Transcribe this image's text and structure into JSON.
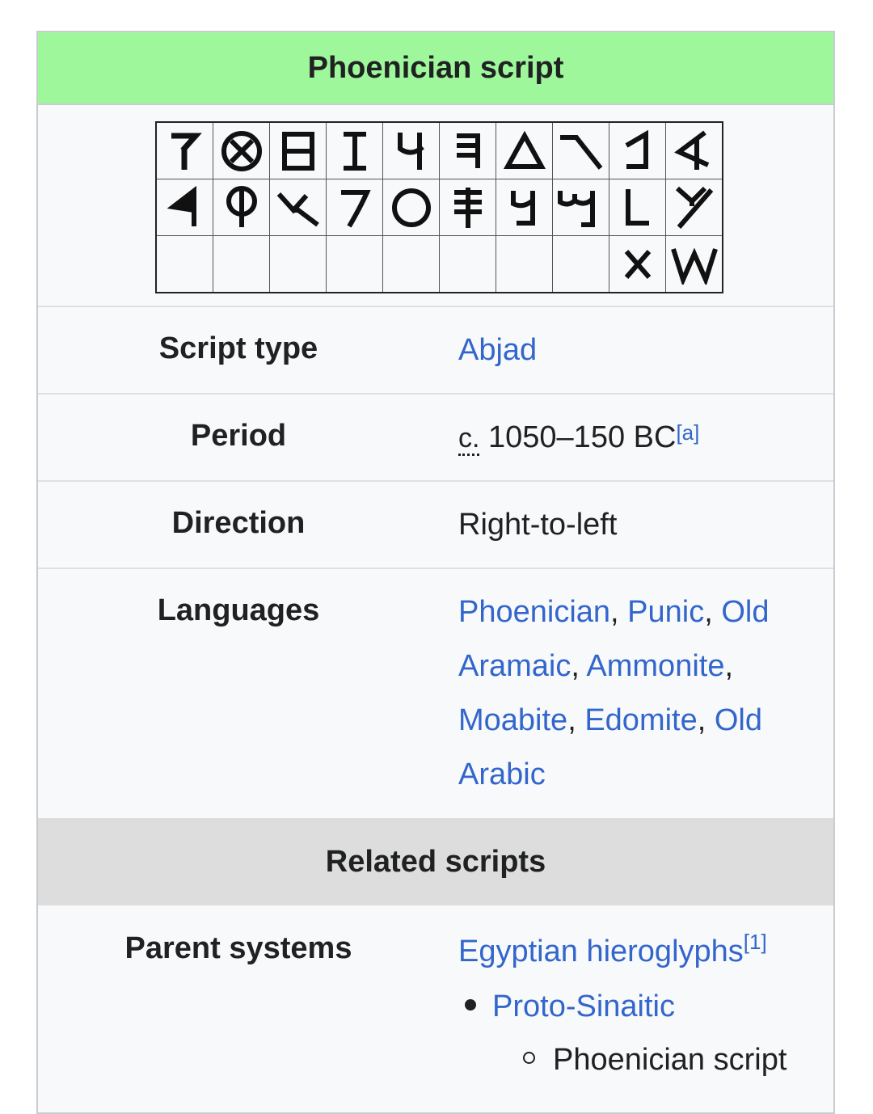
{
  "infobox": {
    "title": "Phoenician script",
    "rows": [
      {
        "label": "Script type",
        "value": "Abjad"
      },
      {
        "label": "Period",
        "abbr": "c.",
        "value": " 1050–150 BC",
        "note": "[a]"
      },
      {
        "label": "Direction",
        "value": "Right-to-left"
      },
      {
        "label": "Languages",
        "links": [
          "Phoenician",
          "Punic",
          "Old Aramaic",
          "Ammonite",
          "Moabite",
          "Edomite",
          "Old Arabic"
        ]
      }
    ],
    "section_header": "Related scripts",
    "parent": {
      "label": "Parent systems",
      "root": "Egyptian hieroglyphs",
      "root_note": "[1]",
      "child": "Proto-Sinaitic",
      "grandchild": "Phoenician script"
    }
  },
  "glyph_chart_icons": [
    "zayin-glyph",
    "teth-glyph",
    "heth-glyph",
    "zayin-i-glyph",
    "waw-glyph",
    "he-glyph",
    "daleth-glyph",
    "gimel-glyph",
    "bet-glyph",
    "aleph-glyph",
    "resh-glyph",
    "qoph-glyph",
    "sade-glyph",
    "pe-glyph",
    "ayin-glyph",
    "samekh-glyph",
    "nun-glyph",
    "mem-glyph",
    "lamed-glyph",
    "kaph-glyph",
    "taw-glyph",
    "shin-glyph"
  ]
}
